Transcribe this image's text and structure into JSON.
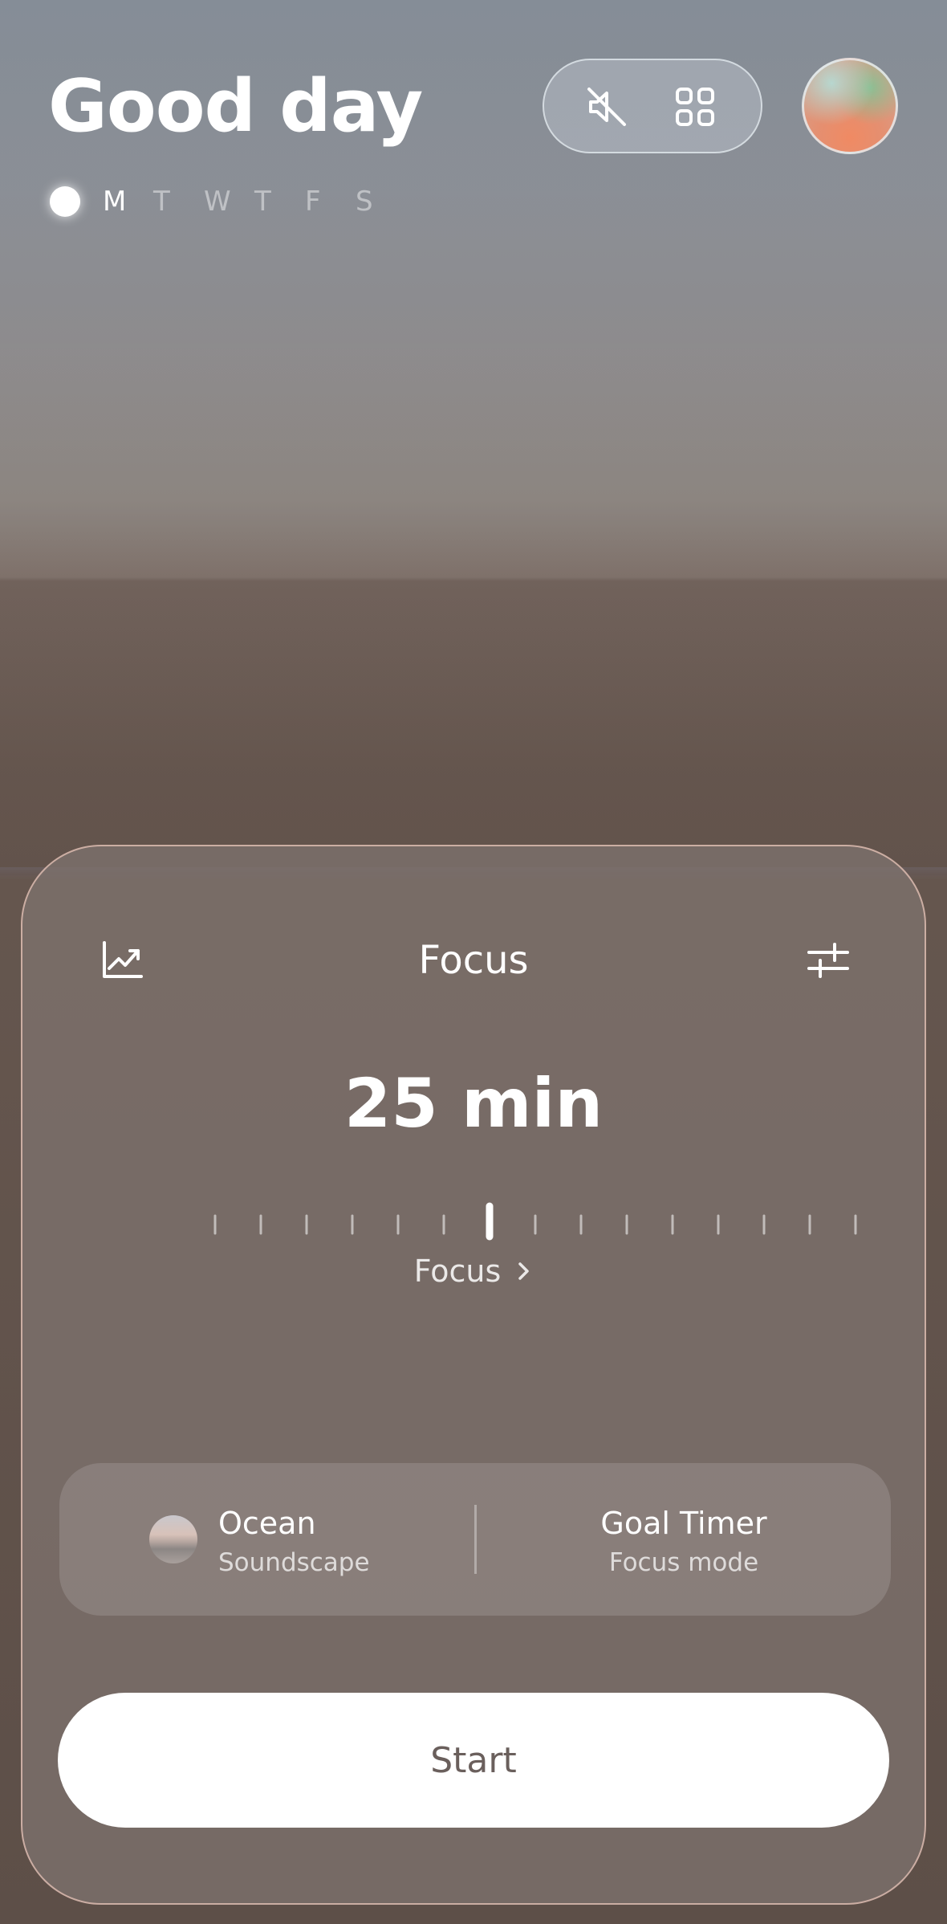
{
  "header": {
    "greeting": "Good day",
    "weekdays": [
      "M",
      "T",
      "W",
      "T",
      "F",
      "S"
    ],
    "active_day_index": 0
  },
  "toolbar": {
    "mute_icon": "speaker-muted-icon",
    "apps_icon": "grid-icon"
  },
  "profile": {
    "avatar_icon": "gradient-avatar"
  },
  "focus_card": {
    "title": "Focus",
    "stats_icon": "chart-trend-icon",
    "settings_icon": "sliders-icon",
    "duration": "25 min",
    "mode_link": "Focus",
    "options": {
      "sound": {
        "title": "Ocean",
        "subtitle": "Soundscape"
      },
      "timer": {
        "title": "Goal Timer",
        "subtitle": "Focus mode"
      }
    },
    "start_label": "Start"
  },
  "colors": {
    "text": "#ffffff",
    "button_bg": "#ffffff",
    "button_text": "#6a5f5c",
    "card_border": "#e8c4b8"
  }
}
